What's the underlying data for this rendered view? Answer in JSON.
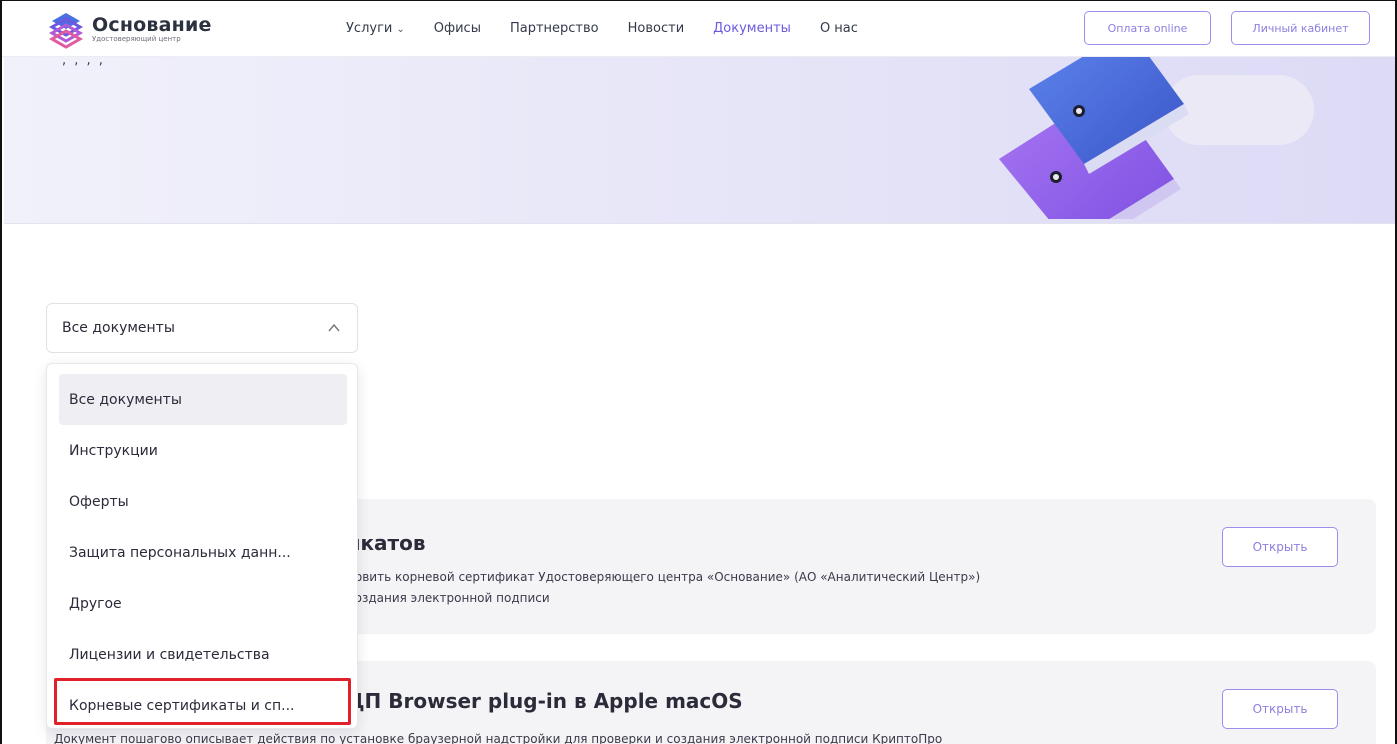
{
  "header": {
    "logo_title": "Основание",
    "logo_subtitle": "Удостоверяющий центр",
    "nav": [
      {
        "label": "Услуги",
        "has_dropdown": true
      },
      {
        "label": "Офисы"
      },
      {
        "label": "Партнерство"
      },
      {
        "label": "Новости"
      },
      {
        "label": "Документы",
        "active": true
      },
      {
        "label": "О нас"
      }
    ],
    "pay_button": "Оплата online",
    "cabinet_button": "Личный кабинет"
  },
  "filter": {
    "selected": "Все документы",
    "options": [
      "Все документы",
      "Инструкции",
      "Оферты",
      "Защита персональных данн...",
      "Другое",
      "Лицензии и свидетельства",
      "Корневые сертификаты и сп..."
    ]
  },
  "documents": [
    {
      "title_visible": "тификатов",
      "desc_line1": "но установить корневой сертификат Удостоверяющего центра «Основание» (АО «Аналитический Центр»)",
      "desc_line2": "для создания электронной подписи",
      "open_label": "Открыть"
    },
    {
      "title_visible": "ЦП Browser plug-in в Apple macOS",
      "desc_line1": "Документ пошагово описывает действия по установке браузерной надстройки для проверки и создания электронной подписи КриптоПро",
      "open_label": "Открыть"
    }
  ],
  "colors": {
    "accent": "#6a5ae0",
    "button_border": "#9b8ef0",
    "highlight_box": "#e0202a",
    "hero_bg": "#e8e7f8",
    "card_bg": "#f4f4f7"
  }
}
